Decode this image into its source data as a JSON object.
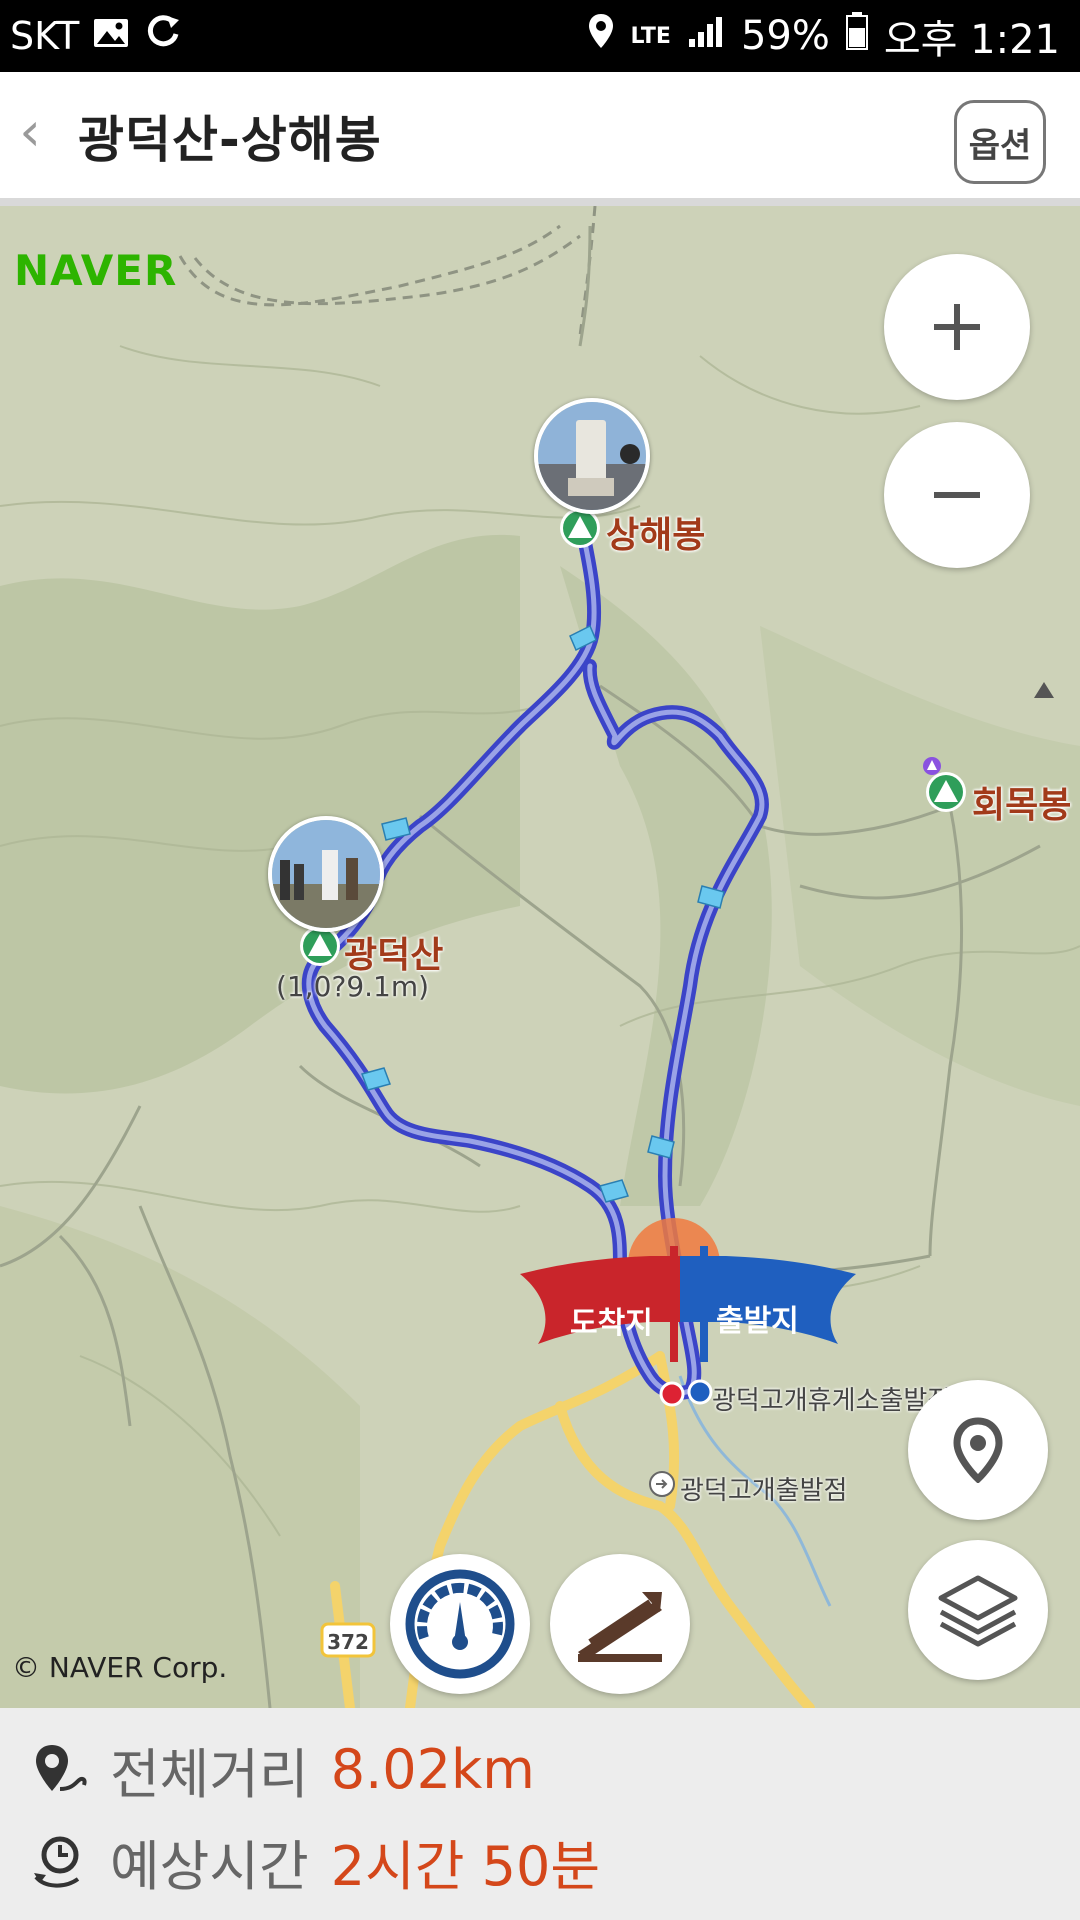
{
  "status_bar": {
    "carrier": "SKT",
    "network": "LTE",
    "battery": "59%",
    "time": "오후 1:21"
  },
  "header": {
    "title": "광덕산-상해봉",
    "options_label": "옵션"
  },
  "map": {
    "provider_logo": "NAVER",
    "copyright": "© NAVER Corp.",
    "peaks": [
      {
        "name": "상해봉"
      },
      {
        "name": "광덕산",
        "elevation": "(1,0?9.1m)"
      },
      {
        "name": "회목봉"
      }
    ],
    "flags": {
      "arrival": "도착지",
      "departure": "출발지"
    },
    "pois": [
      "광덕고개휴게소출발점",
      "광덕고개출발점"
    ],
    "road_number": "372",
    "route_color": "#2233cc"
  },
  "summary": {
    "distance_label": "전체거리",
    "distance_value": "8.02km",
    "time_label": "예상시간",
    "time_value": "2시간 50분"
  }
}
